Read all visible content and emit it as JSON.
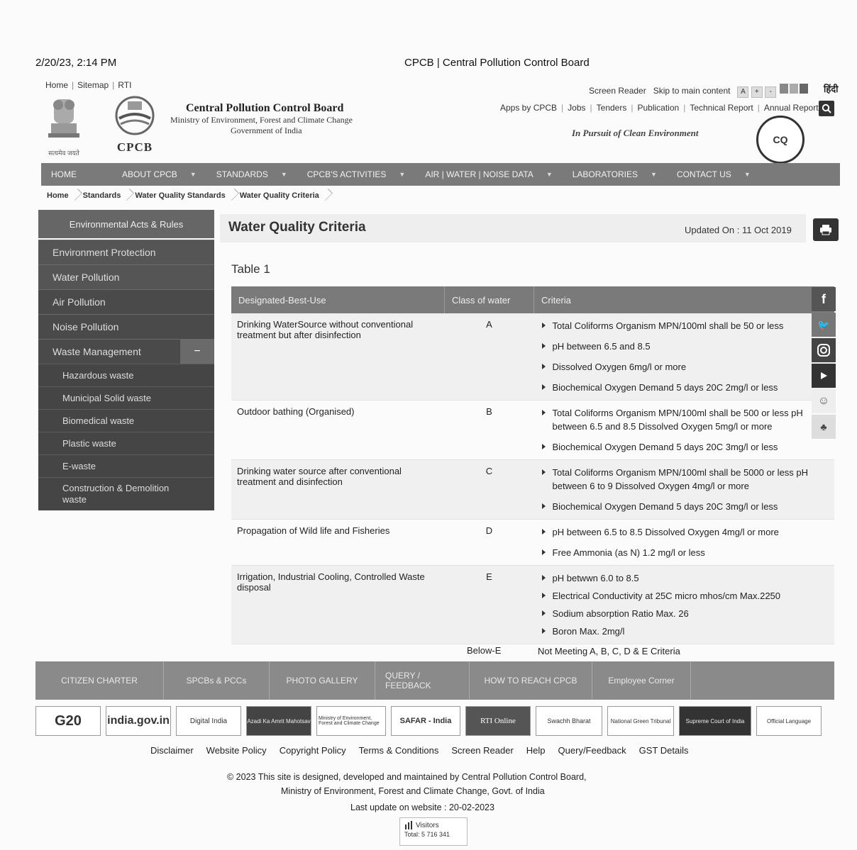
{
  "print_header": {
    "datetime": "2/20/23, 2:14 PM",
    "title": "CPCB | Central Pollution Control Board"
  },
  "top_links": [
    "Home",
    "Sitemap",
    "RTI"
  ],
  "utility": {
    "screen_reader": "Screen Reader",
    "skip": "Skip to main content",
    "font_a": "A",
    "font_plus": "+",
    "font_minus": "-",
    "hindi": "हिंदी"
  },
  "org": {
    "name": "Central Pollution Control Board",
    "ministry": "Ministry of Environment, Forest and Climate Change",
    "gov": "Government of India",
    "logo_text": "CPCB",
    "emblem_caption": "सत्यमेव जयते"
  },
  "header_links": [
    "Apps by CPCB",
    "Jobs",
    "Tenders",
    "Publication",
    "Technical Report",
    "Annual Report"
  ],
  "tagline": "In Pursuit of Clean Environment",
  "cq_badge": "CQ",
  "nav": [
    "HOME",
    "ABOUT CPCB",
    "STANDARDS",
    "CPCB'S ACTIVITIES",
    "AIR | WATER | NOISE DATA",
    "LABORATORIES",
    "CONTACT US"
  ],
  "breadcrumb": [
    "Home",
    "Standards",
    "Water Quality Standards",
    "Water Quality Criteria"
  ],
  "sidebar": {
    "header": "Environmental Acts & Rules",
    "items": [
      "Environment Protection",
      "Water Pollution",
      "Air Pollution",
      "Noise Pollution"
    ],
    "active": "Waste Management",
    "sub_items": [
      "Hazardous waste",
      "Municipal Solid waste",
      "Biomedical waste",
      "Plastic waste",
      "E-waste",
      "Construction & Demolition waste"
    ]
  },
  "page": {
    "title": "Water Quality Criteria",
    "updated": "Updated On : 11 Oct 2019",
    "table_label": "Table 1"
  },
  "table": {
    "headers": [
      "Designated-Best-Use",
      "Class of water",
      "Criteria"
    ],
    "rows": [
      {
        "use": "Drinking WaterSource without conventional treatment but after disinfection",
        "class": "A",
        "criteria": [
          "Total Coliforms Organism MPN/100ml shall be 50 or less",
          "pH between 6.5 and 8.5",
          "Dissolved Oxygen 6mg/l or more",
          "Biochemical Oxygen Demand 5 days 20C 2mg/l or less"
        ]
      },
      {
        "use": "Outdoor bathing (Organised)",
        "class": "B",
        "criteria": [
          "Total Coliforms Organism MPN/100ml shall be 500 or less pH between 6.5 and 8.5 Dissolved Oxygen 5mg/l or more",
          "Biochemical Oxygen Demand 5 days 20C 3mg/l or less"
        ]
      },
      {
        "use": "Drinking water source after conventional treatment and disinfection",
        "class": "C",
        "criteria": [
          "Total Coliforms Organism MPN/100ml shall be 5000 or less pH between 6 to 9 Dissolved Oxygen 4mg/l or more",
          "Biochemical Oxygen Demand 5 days 20C 3mg/l or less"
        ]
      },
      {
        "use": "Propagation of Wild life and Fisheries",
        "class": "D",
        "criteria": [
          "pH between 6.5 to 8.5 Dissolved Oxygen 4mg/l or more",
          "Free Ammonia (as N) 1.2 mg/l or less"
        ]
      },
      {
        "use": "Irrigation, Industrial Cooling, Controlled Waste disposal",
        "class": "E",
        "criteria": [
          "pH betwwn 6.0 to 8.5",
          "Electrical Conductivity at 25C micro mhos/cm Max.2250",
          "Sodium absorption Ratio Max. 26",
          "Boron Max. 2mg/l"
        ]
      }
    ],
    "below": {
      "class": "Below-E",
      "criteria": "Not Meeting A, B, C, D & E Criteria"
    }
  },
  "social": [
    "f",
    "t",
    "ig",
    "yt"
  ],
  "footer_nav": [
    "CITIZEN CHARTER",
    "SPCBs & PCCs",
    "PHOTO GALLERY",
    "QUERY / FEEDBACK",
    "HOW TO REACH CPCB",
    "Employee Corner"
  ],
  "partner_logos": [
    "G20",
    "india.gov.in",
    "Digital India",
    "Azadi Ka Amrit Mahotsav",
    "Ministry of Environment, Forest and Climate Change",
    "SAFAR - India",
    "RTI Online",
    "Swachh Bharat",
    "National Green Tribunal",
    "Supreme Court of India",
    "Official Language"
  ],
  "footer_links": [
    "Disclaimer",
    "Website Policy",
    "Copyright Policy",
    "Terms & Conditions",
    "Screen Reader",
    "Help",
    "Query/Feedback",
    "GST Details"
  ],
  "copyright": {
    "line1": "© 2023 This site is designed, developed and maintained by Central Pollution Control Board,",
    "line2": "Ministry of Environment, Forest and Climate Change, Govt. of India",
    "last_update": "Last update on website : 20-02-2023"
  },
  "visitors": {
    "label": "Visitors",
    "total": "Total: 5 716 341"
  }
}
